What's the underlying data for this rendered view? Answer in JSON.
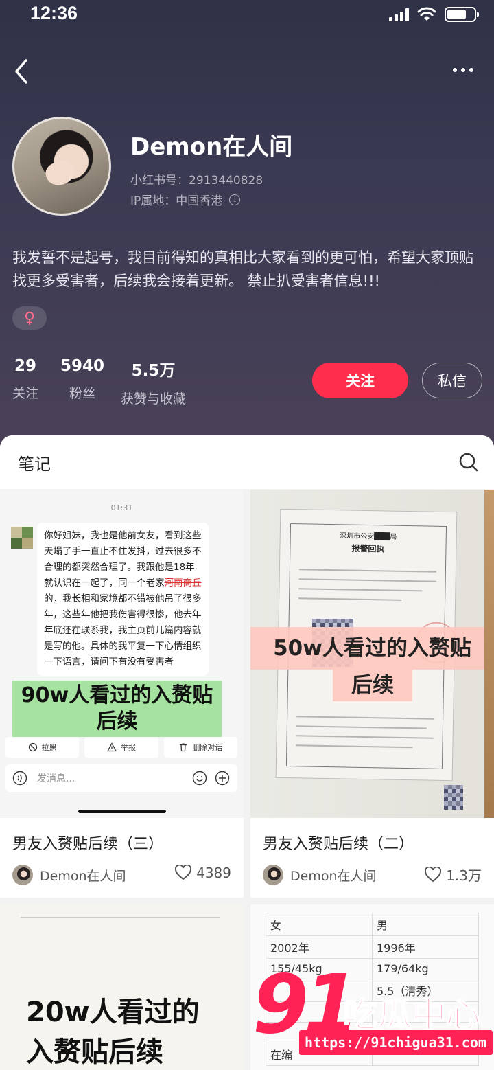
{
  "status_bar": {
    "time": "12:36"
  },
  "profile": {
    "username": "Demon在人间",
    "redbook_id": "小红书号：2913440828",
    "ip_location": "IP属地：中国香港",
    "bio": "我发誓不是起号，我目前得知的真相比大家看到的更可怕，希望大家顶贴找更多受害者，后续我会接着更新。 禁止扒受害者信息!!!",
    "gender_symbol": "♀"
  },
  "stats": [
    {
      "value": "29",
      "label": "关注"
    },
    {
      "value": "5940",
      "label": "粉丝"
    },
    {
      "value": "5.5万",
      "label": "获赞与收藏"
    }
  ],
  "actions": {
    "follow_label": "关注",
    "message_label": "私信"
  },
  "tabs": {
    "notes_label": "笔记"
  },
  "colors": {
    "accent": "#ff2e4d",
    "header_bg": "#3a3a52"
  },
  "notes": [
    {
      "title": "男友入赘贴后续（三）",
      "author": "Demon在人间",
      "likes": "4389",
      "image": {
        "time": "01:31",
        "message_a": "你好姐妹，我也是他前女友，看到这些天塌了手一直止不住发抖，过去很多不合理的都突然合理了。我跟他是18年就认识在一起了，同一个老家",
        "message_strike": "河南商丘",
        "message_b": "的，我长相和家境都不错被他吊了很多年，这些年他把我伤害得很惨，他去年年底还在联系我，我主页前几篇内容就是写的他。具体的我平复一下心情组织一下语言，请问下有没有受害者",
        "banner_line1": "90w人看过的入赘贴",
        "banner_line2": "后续",
        "action_block": "拉黑",
        "action_report": "举报",
        "action_delete": "删除对话",
        "input_placeholder": "发消息..."
      }
    },
    {
      "title": "男友入赘贴后续（二）",
      "author": "Demon在人间",
      "likes": "1.3万",
      "image": {
        "doc_title": "深圳市公安███局",
        "doc_subtitle": "报警回执",
        "banner_line1": "50w人看过的入赘贴",
        "banner_line2": "后续"
      }
    },
    {
      "image": {
        "text_line1": "20w人看过的",
        "text_line2": "入赘贴后续"
      }
    },
    {
      "image": {
        "rows": [
          [
            "女",
            "男"
          ],
          [
            "2002年",
            "1996年"
          ],
          [
            "155/45kg",
            "179/64kg"
          ],
          [
            "",
            "5.5（清秀）"
          ],
          [
            "",
            ""
          ],
          [
            "",
            ""
          ],
          [
            "在编",
            ""
          ]
        ]
      }
    }
  ],
  "watermark": {
    "number": "91",
    "brand": "吃瓜中心",
    "url": "https://91chigua31.com"
  }
}
